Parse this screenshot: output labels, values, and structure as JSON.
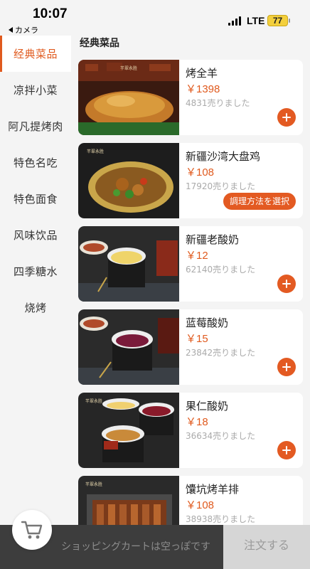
{
  "status_bar": {
    "time": "10:07",
    "back_label": "カメラ",
    "network": "LTE",
    "battery": "77"
  },
  "sidebar": {
    "categories": [
      {
        "label": "经典菜品",
        "active": true
      },
      {
        "label": "凉拌小菜"
      },
      {
        "label": "阿凡提烤肉"
      },
      {
        "label": "特色名吃"
      },
      {
        "label": "特色面食"
      },
      {
        "label": "风味饮品"
      },
      {
        "label": "四季糖水"
      },
      {
        "label": "烧烤"
      }
    ]
  },
  "main": {
    "section_title": "经典菜品",
    "items": [
      {
        "name": "烤全羊",
        "price": "￥1398",
        "sold": "4831売りました",
        "action": "add-icon"
      },
      {
        "name": "新疆沙湾大盘鸡",
        "price": "￥108",
        "sold": "17920売りました",
        "action_label": "調理方法を選択"
      },
      {
        "name": "新疆老酸奶",
        "price": "￥12",
        "sold": "62140売りました",
        "action": "add-icon"
      },
      {
        "name": "蓝莓酸奶",
        "price": "￥15",
        "sold": "23842売りました",
        "action": "add-icon"
      },
      {
        "name": "果仁酸奶",
        "price": "￥18",
        "sold": "36634売りました",
        "action": "add-icon"
      },
      {
        "name": "馕坑烤羊排",
        "price": "￥108",
        "sold": "38938売りました"
      }
    ]
  },
  "cart": {
    "icon": "shopping-cart-icon",
    "empty_text": "ショッピングカートは空っぽです",
    "checkout_label": "注文する"
  },
  "colors": {
    "accent": "#e35a22",
    "cart_bar": "#3d3d3d"
  }
}
